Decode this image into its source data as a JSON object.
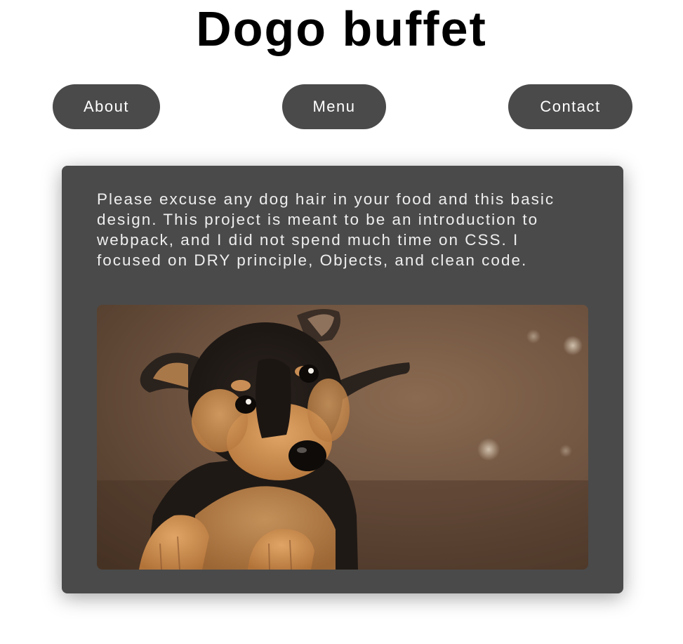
{
  "header": {
    "title": "Dogo buffet"
  },
  "nav": {
    "about_label": "About",
    "menu_label": "Menu",
    "contact_label": "Contact"
  },
  "main": {
    "intro_text": "Please excuse any dog hair in your food and this basic design. This project is meant to be an introduction to webpack, and I did not spend much time on CSS. I focused on DRY principle, Objects, and clean code.",
    "image_icon": "puppy-photo"
  },
  "colors": {
    "button_bg": "#4a4a4a",
    "card_bg": "#4a4a4a",
    "card_text": "#eeeeee",
    "title": "#000000"
  }
}
